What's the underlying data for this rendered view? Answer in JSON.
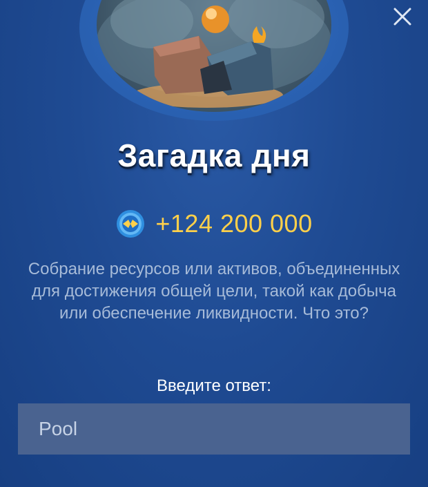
{
  "modal": {
    "title": "Загадка дня",
    "reward": "+124 200 000",
    "question": "Собрание ресурсов или активов, объединенных для достижения общей цели, такой как добыча или обеспечение ликвидности. Что это?",
    "answer_label": "Введите ответ:",
    "answer_value": "Pool",
    "close_icon": "close-icon",
    "coin_icon": "coin-icon"
  },
  "colors": {
    "background": "#1f4b93",
    "reward": "#ffd04a",
    "question_text": "#a7bbd8",
    "input_bg": "#4a6390"
  }
}
